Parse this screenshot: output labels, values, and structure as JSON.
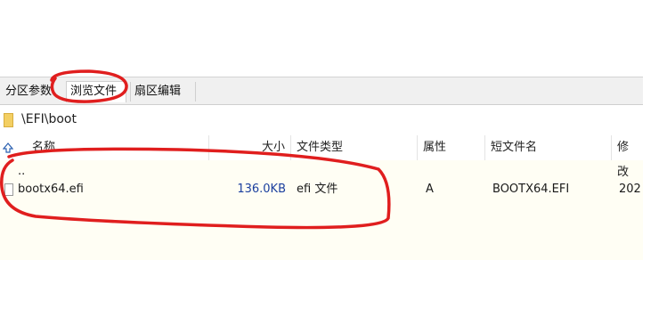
{
  "tabs": [
    {
      "label": "分区参数"
    },
    {
      "label": "浏览文件"
    },
    {
      "label": "扇区编辑"
    }
  ],
  "path": "\\EFI\\boot",
  "columns": {
    "name": "名称",
    "size": "大小",
    "type": "文件类型",
    "attr": "属性",
    "short": "短文件名",
    "modified": "修改"
  },
  "rows": [
    {
      "name": "..",
      "size": "",
      "type": "",
      "attr": "",
      "short": "",
      "modified": ""
    },
    {
      "name": "bootx64.efi",
      "size": "136.0KB",
      "type": "efi 文件",
      "attr": "A",
      "short": "BOOTX64.EFI",
      "modified": "202"
    }
  ],
  "colors": {
    "annotation": "#e01e1e",
    "size_text": "#1b3f9e",
    "folder": "#f3cf63"
  }
}
